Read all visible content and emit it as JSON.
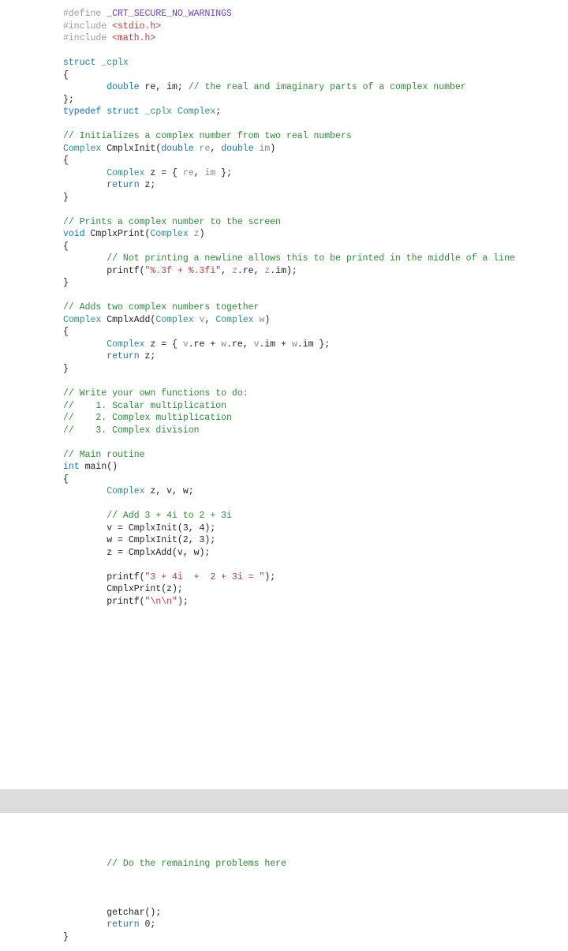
{
  "code": {
    "l1a": "#define ",
    "l1b": "_CRT_SECURE_NO_WARNINGS",
    "l2a": "#include ",
    "l2b": "<stdio.h>",
    "l3a": "#include ",
    "l3b": "<math.h>",
    "l5a": "struct",
    "l5b": " _cplx",
    "l6": "{",
    "l7a": "        double",
    "l7b": " re, im; ",
    "l7c": "// the real and imaginary parts of a complex number",
    "l8": "};",
    "l9a": "typedef",
    "l9b": " struct",
    "l9c": " _cplx",
    "l9d": " Complex",
    "l9e": ";",
    "l11": "// Initializes a complex number from two real numbers",
    "l12a": "Complex",
    "l12b": " CmplxInit(",
    "l12c": "double",
    "l12d": " re",
    "l12e": ", ",
    "l12f": "double",
    "l12g": " im",
    "l12h": ")",
    "l13": "{",
    "l14a": "        Complex",
    "l14b": " z = { ",
    "l14c": "re",
    "l14d": ", ",
    "l14e": "im",
    "l14f": " };",
    "l15a": "        return",
    "l15b": " z;",
    "l16": "}",
    "l18": "// Prints a complex number to the screen",
    "l19a": "void",
    "l19b": " CmplxPrint(",
    "l19c": "Complex",
    "l19d": " z",
    "l19e": ")",
    "l20": "{",
    "l21": "        // Not printing a newline allows this to be printed in the middle of a line",
    "l22a": "        printf(",
    "l22b": "\"%.3f + %.3fi\"",
    "l22c": ", ",
    "l22d": "z",
    "l22e": ".re, ",
    "l22f": "z",
    "l22g": ".im);",
    "l23": "}",
    "l25": "// Adds two complex numbers together",
    "l26a": "Complex",
    "l26b": " CmplxAdd(",
    "l26c": "Complex",
    "l26d": " v",
    "l26e": ", ",
    "l26f": "Complex",
    "l26g": " w",
    "l26h": ")",
    "l27": "{",
    "l28a": "        Complex",
    "l28b": " z = { ",
    "l28c": "v",
    "l28d": ".re + ",
    "l28e": "w",
    "l28f": ".re, ",
    "l28g": "v",
    "l28h": ".im + ",
    "l28i": "w",
    "l28j": ".im };",
    "l29a": "        return",
    "l29b": " z;",
    "l30": "}",
    "l32": "// Write your own functions to do:",
    "l33": "//    1. Scalar multiplication",
    "l34": "//    2. Complex multiplication",
    "l35": "//    3. Complex division",
    "l37": "// Main routine",
    "l38a": "int",
    "l38b": " main()",
    "l39": "{",
    "l40a": "        Complex",
    "l40b": " z, v, w;",
    "l42": "        // Add 3 + 4i to 2 + 3i",
    "l43": "        v = CmplxInit(3, 4);",
    "l44": "        w = CmplxInit(2, 3);",
    "l45": "        z = CmplxAdd(v, w);",
    "l47a": "        printf(",
    "l47b": "\"3 + 4i  +  2 + 3i = \"",
    "l47c": ");",
    "l48": "        CmplxPrint(z);",
    "l49a": "        printf(",
    "l49b": "\"\\n\\n\"",
    "l49c": ");",
    "l55": "        // Do the remaining problems here",
    "l58": "        getchar();",
    "l59a": "        return",
    "l59b": " 0;",
    "l60": "}"
  }
}
